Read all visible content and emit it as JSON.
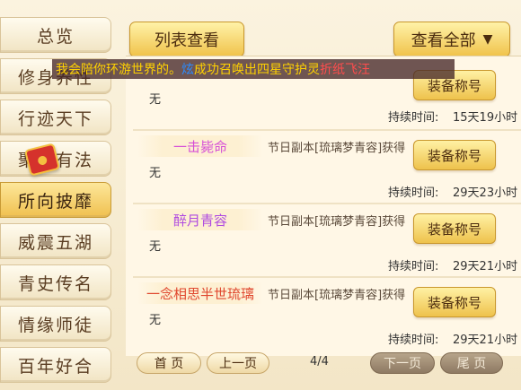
{
  "sidebar": {
    "items": [
      {
        "label": "总览"
      },
      {
        "label": "修身养性"
      },
      {
        "label": "行迹天下"
      },
      {
        "label": "聚宝有法"
      },
      {
        "label": "所向披靡"
      },
      {
        "label": "威震五湖"
      },
      {
        "label": "青史传名"
      },
      {
        "label": "情缘师徒"
      },
      {
        "label": "百年好合"
      }
    ],
    "active_index": 4
  },
  "toolbar": {
    "list_view_label": "列表查看",
    "view_all_label": "查看全部",
    "view_all_icon": "chevron-down-icon"
  },
  "broadcast": {
    "part1": "我会陪你环游世界的。",
    "name": "炫",
    "part2": "成功召唤出四星守护灵",
    "pet": "折纸飞汪"
  },
  "titles": [
    {
      "name": "",
      "name_color": "",
      "source": "",
      "desc": "无",
      "duration_label": "持续时间:",
      "duration": "15天19小时",
      "equip_label": "装备称号"
    },
    {
      "name": "一击毙命",
      "name_color": "#d64fd6",
      "source": "节日副本[琉璃梦青容]获得",
      "desc": "无",
      "duration_label": "持续时间:",
      "duration": "29天23小时",
      "equip_label": "装备称号"
    },
    {
      "name": "醉月青容",
      "name_color": "#b04be0",
      "source": "节日副本[琉璃梦青容]获得",
      "desc": "无",
      "duration_label": "持续时间:",
      "duration": "29天21小时",
      "equip_label": "装备称号"
    },
    {
      "name": "一念相思半世琉璃",
      "name_color": "#e0482f",
      "source": "节日副本[琉璃梦青容]获得",
      "desc": "无",
      "duration_label": "持续时间:",
      "duration": "29天21小时",
      "equip_label": "装备称号"
    }
  ],
  "pagination": {
    "first": "首 页",
    "prev": "上一页",
    "page_info": "4/4",
    "next": "下一页",
    "last": "尾 页"
  }
}
